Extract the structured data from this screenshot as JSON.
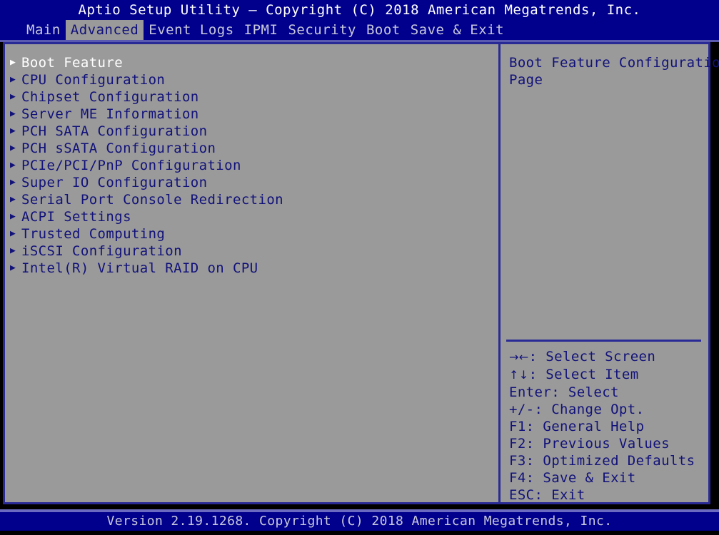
{
  "titlebar": {
    "title": "Aptio Setup Utility – Copyright (C) 2018 American Megatrends, Inc."
  },
  "menubar": {
    "tabs": [
      {
        "label": "Main",
        "active": false
      },
      {
        "label": "Advanced",
        "active": true
      },
      {
        "label": "Event Logs",
        "active": false
      },
      {
        "label": "IPMI",
        "active": false
      },
      {
        "label": "Security",
        "active": false
      },
      {
        "label": "Boot",
        "active": false
      },
      {
        "label": "Save & Exit",
        "active": false
      }
    ]
  },
  "main_menu": {
    "items": [
      {
        "label": "Boot Feature",
        "selected": true
      },
      {
        "label": "CPU Configuration",
        "selected": false
      },
      {
        "label": "Chipset Configuration",
        "selected": false
      },
      {
        "label": "Server ME Information",
        "selected": false
      },
      {
        "label": "PCH SATA Configuration",
        "selected": false
      },
      {
        "label": "PCH sSATA Configuration",
        "selected": false
      },
      {
        "label": "PCIe/PCI/PnP Configuration",
        "selected": false
      },
      {
        "label": "Super IO Configuration",
        "selected": false
      },
      {
        "label": "Serial Port Console Redirection",
        "selected": false
      },
      {
        "label": "ACPI Settings",
        "selected": false
      },
      {
        "label": "Trusted Computing",
        "selected": false
      },
      {
        "label": "iSCSI Configuration",
        "selected": false
      },
      {
        "label": "Intel(R) Virtual RAID on CPU",
        "selected": false
      }
    ],
    "submenu_marker": "▶"
  },
  "help_panel": {
    "lines": [
      "Boot Feature Configuration",
      "Page"
    ]
  },
  "key_legend": {
    "entries": [
      {
        "glyph": "→←",
        "text": ": Select Screen"
      },
      {
        "glyph": "↑↓",
        "text": ": Select Item"
      },
      {
        "glyph": "",
        "text": "Enter: Select"
      },
      {
        "glyph": "",
        "text": "+/-: Change Opt."
      },
      {
        "glyph": "",
        "text": "F1: General Help"
      },
      {
        "glyph": "",
        "text": "F2: Previous Values"
      },
      {
        "glyph": "",
        "text": "F3: Optimized Defaults"
      },
      {
        "glyph": "",
        "text": "F4: Save & Exit"
      },
      {
        "glyph": "",
        "text": "ESC: Exit"
      }
    ]
  },
  "footer": {
    "version": "Version 2.19.1268. Copyright (C) 2018 American Megatrends, Inc."
  },
  "colors": {
    "bar_blue": "#00008c",
    "panel_gray": "#9a9a9a",
    "text_navy": "#11117a",
    "border_blue": "#2a2a96",
    "selected_white": "#ffffff"
  }
}
